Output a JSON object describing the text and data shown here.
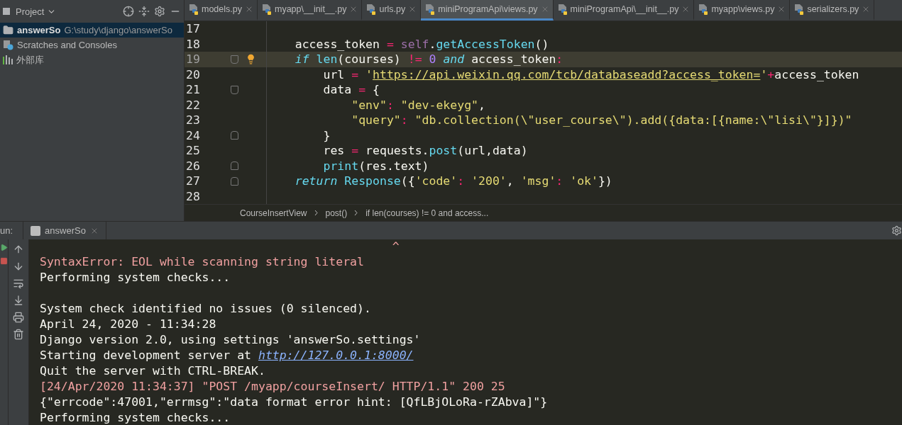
{
  "project": {
    "title": "Project",
    "tree": [
      {
        "label": "answerSo",
        "path": "G:\\study\\django\\answerSo",
        "selected": true
      },
      {
        "label": "Scratches and Consoles",
        "selected": false
      },
      {
        "label": "外部库",
        "selected": false
      }
    ]
  },
  "tabs": [
    {
      "label": "models.py",
      "selected": false
    },
    {
      "label": "myapp\\__init__.py",
      "selected": false
    },
    {
      "label": "urls.py",
      "selected": false
    },
    {
      "label": "miniProgramApi\\views.py",
      "selected": true
    },
    {
      "label": "miniProgramApi\\__init__.py",
      "selected": false
    },
    {
      "label": "myapp\\views.py",
      "selected": false
    },
    {
      "label": "serializers.py",
      "selected": false
    }
  ],
  "editor": {
    "lines": [
      {
        "number": "17",
        "current": false
      },
      {
        "number": "18",
        "current": false,
        "tokens": [
          {
            "kind": "plain",
            "t": "    access_token "
          },
          {
            "kind": "op",
            "t": "="
          },
          {
            "kind": "self",
            "t": " self"
          },
          {
            "kind": "plain",
            "t": "."
          },
          {
            "kind": "func",
            "t": "getAccessToken"
          },
          {
            "kind": "plain",
            "t": "()"
          }
        ]
      },
      {
        "number": "19",
        "current": true,
        "kind": "fold-start",
        "bulb": true,
        "tokens": [
          {
            "kind": "kw",
            "t": "    if"
          },
          {
            "kind": "func",
            "t": " len"
          },
          {
            "kind": "plain",
            "t": "(courses) "
          },
          {
            "kind": "op",
            "t": "!="
          },
          {
            "kind": "num",
            "t": " 0"
          },
          {
            "kind": "kw",
            "t": " and"
          },
          {
            "kind": "plain",
            "t": " access_token"
          },
          {
            "kind": "op",
            "t": ":"
          }
        ]
      },
      {
        "number": "20",
        "current": false,
        "tokens": [
          {
            "kind": "plain",
            "t": "        url "
          },
          {
            "kind": "op",
            "t": "="
          },
          {
            "kind": "str",
            "t": " '"
          },
          {
            "kind": "url",
            "t": "https://api.weixin.qq.com/tcb/databaseadd?access_token="
          },
          {
            "kind": "str",
            "t": "'"
          },
          {
            "kind": "op",
            "t": "+"
          },
          {
            "kind": "plain",
            "t": "access_token"
          }
        ]
      },
      {
        "number": "21",
        "current": false,
        "kind": "fold-start",
        "tokens": [
          {
            "kind": "plain",
            "t": "        data "
          },
          {
            "kind": "op",
            "t": "="
          },
          {
            "kind": "plain",
            "t": " {"
          }
        ]
      },
      {
        "number": "22",
        "current": false,
        "tokens": [
          {
            "kind": "str",
            "t": "            \"env\""
          },
          {
            "kind": "op",
            "t": ":"
          },
          {
            "kind": "str",
            "t": " \"dev-ekeyg\""
          },
          {
            "kind": "plain",
            "t": ","
          }
        ]
      },
      {
        "number": "23",
        "current": false,
        "tokens": [
          {
            "kind": "str",
            "t": "            \"query\""
          },
          {
            "kind": "op",
            "t": ":"
          },
          {
            "kind": "str",
            "t": " \"db.collection(\\\"user_course\\\").add({data:[{name:\\\"lisi\\\"}]})\""
          }
        ]
      },
      {
        "number": "24",
        "current": false,
        "kind": "fold-end",
        "tokens": [
          {
            "kind": "plain",
            "t": "        }"
          }
        ]
      },
      {
        "number": "25",
        "current": false,
        "tokens": [
          {
            "kind": "plain",
            "t": "        res "
          },
          {
            "kind": "op",
            "t": "="
          },
          {
            "kind": "plain",
            "t": " requests."
          },
          {
            "kind": "func",
            "t": "post"
          },
          {
            "kind": "plain",
            "t": "(url,data)"
          }
        ]
      },
      {
        "number": "26",
        "current": false,
        "kind": "fold-end",
        "tokens": [
          {
            "kind": "func",
            "t": "        print"
          },
          {
            "kind": "plain",
            "t": "(res.text)"
          }
        ]
      },
      {
        "number": "27",
        "current": false,
        "kind": "fold-end",
        "tokens": [
          {
            "kind": "kw",
            "t": "    return"
          },
          {
            "kind": "func",
            "t": " Response"
          },
          {
            "kind": "plain",
            "t": "({"
          },
          {
            "kind": "str",
            "t": "'code'"
          },
          {
            "kind": "op",
            "t": ":"
          },
          {
            "kind": "str",
            "t": " '200'"
          },
          {
            "kind": "plain",
            "t": ", "
          },
          {
            "kind": "str",
            "t": "'msg'"
          },
          {
            "kind": "op",
            "t": ":"
          },
          {
            "kind": "str",
            "t": " 'ok'"
          },
          {
            "kind": "plain",
            "t": "})"
          }
        ]
      },
      {
        "number": "28",
        "current": false
      }
    ],
    "breadcrumbs": [
      "CourseInsertView",
      "post()",
      "if len(courses) != 0 and access..."
    ]
  },
  "run": {
    "label": "un:",
    "tab": "answerSo",
    "console": [
      {
        "kind": "error",
        "t": "                                                  ^"
      },
      {
        "kind": "error",
        "t": "SyntaxError: EOL while scanning string literal"
      },
      {
        "kind": "plain",
        "t": "Performing system checks..."
      },
      {
        "kind": "blank"
      },
      {
        "kind": "plain",
        "t": "System check identified no issues (0 silenced)."
      },
      {
        "kind": "plain",
        "t": "April 24, 2020 - 11:34:28"
      },
      {
        "kind": "plain",
        "t": "Django version 2.0, using settings 'answerSo.settings'"
      },
      {
        "kind": "link",
        "t": "Starting development server at ",
        "link": "http://127.0.0.1:8000/"
      },
      {
        "kind": "plain",
        "t": "Quit the server with CTRL-BREAK."
      },
      {
        "kind": "log",
        "t": "[24/Apr/2020 11:34:37] \"POST /myapp/courseInsert/ HTTP/1.1\" 200 25"
      },
      {
        "kind": "plain",
        "t": "{\"errcode\":47001,\"errmsg\":\"data format error hint: [QfLBjOLoRa-rZAbva]\"}"
      },
      {
        "kind": "plain",
        "t": "Performing system checks..."
      }
    ]
  }
}
